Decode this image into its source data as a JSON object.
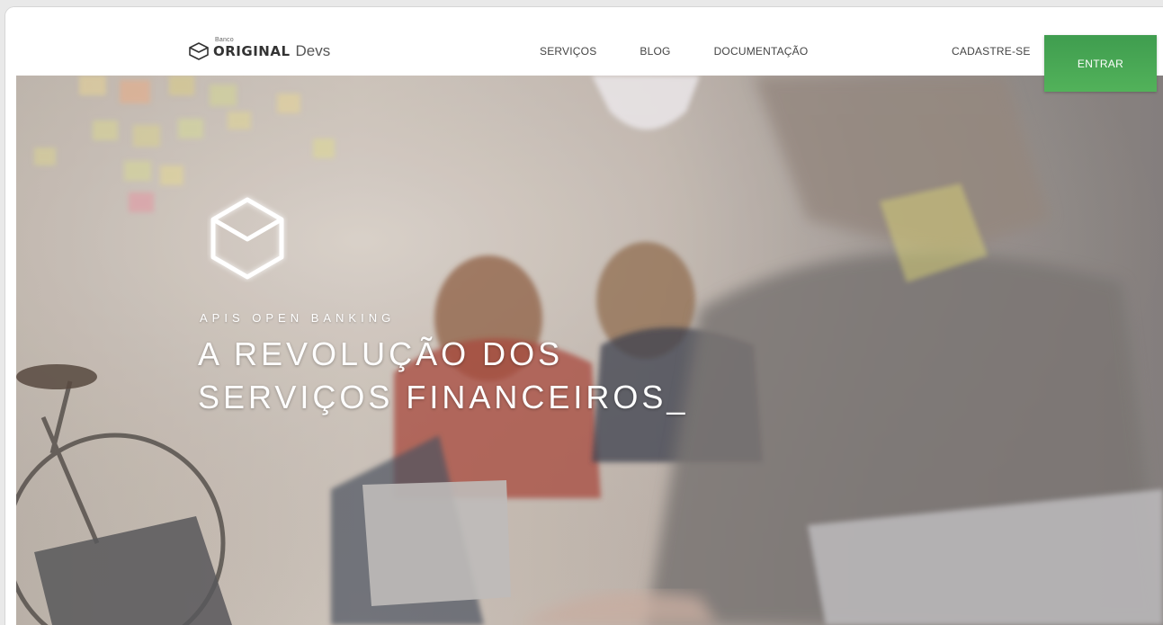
{
  "header": {
    "logo": {
      "small_label": "Banco",
      "brand": "ORIGINAL",
      "suffix": "Devs",
      "icon": "cube-outline-icon"
    },
    "nav": [
      {
        "label": "SERVIÇOS"
      },
      {
        "label": "BLOG"
      },
      {
        "label": "DOCUMENTAÇÃO"
      }
    ],
    "signup_label": "CADASTRE-SE",
    "login_label": "ENTRAR"
  },
  "hero": {
    "icon": "cube-outline-icon",
    "kicker": "APIS OPEN BANKING",
    "title_line1": "A REVOLUÇÃO DOS",
    "title_line2": "SERVIÇOS FINANCEIROS_"
  },
  "colors": {
    "accent_green": "#4caf50",
    "text_dark": "#444444",
    "hero_text": "#ffffff"
  }
}
